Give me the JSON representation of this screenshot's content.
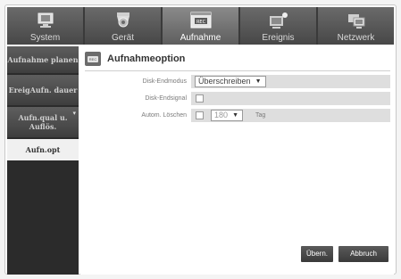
{
  "top_tabs": [
    {
      "label": "System",
      "icon": "monitor-icon"
    },
    {
      "label": "Gerät",
      "icon": "camera-icon"
    },
    {
      "label": "Aufnahme",
      "icon": "rec-icon",
      "active": true
    },
    {
      "label": "Ereignis",
      "icon": "event-icon"
    },
    {
      "label": "Netzwerk",
      "icon": "network-icon"
    }
  ],
  "sidebar": {
    "items": [
      {
        "label": "Aufnahme planen"
      },
      {
        "label": "EreigAufn. dauer"
      },
      {
        "label": "Aufn.qual u. Auflös."
      },
      {
        "label": "Aufn.opt",
        "active": true
      }
    ]
  },
  "main": {
    "title": "Aufnahmeoption",
    "rows": [
      {
        "label": "Disk-Endmodus",
        "value": "Überschreiben"
      },
      {
        "label": "Disk-Endsignal"
      },
      {
        "label": "Autom. Löschen",
        "value": "180",
        "unit": "Tag"
      }
    ]
  },
  "buttons": {
    "ok": "Übern.",
    "cancel": "Abbruch"
  }
}
